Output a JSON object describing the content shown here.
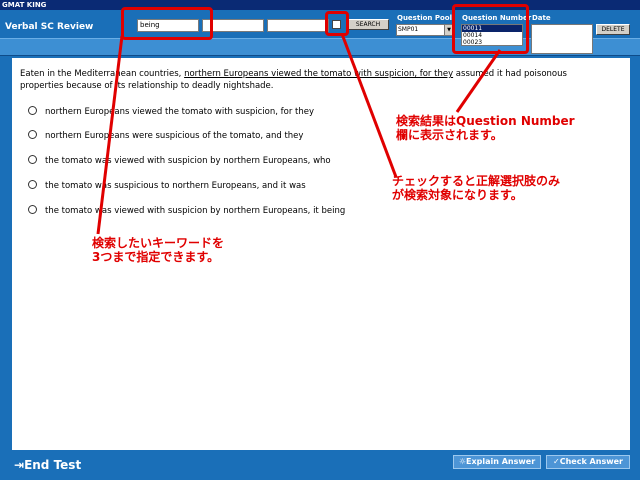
{
  "window": {
    "title": "GMAT KING"
  },
  "header": {
    "app_title": "Verbal SC Review",
    "keyword_inputs": [
      "being",
      "",
      ""
    ],
    "search_label": "SEARCH",
    "question_pool_label": "Question Pool",
    "question_pool_value": "SMP01",
    "question_number_label": "Question Number",
    "question_numbers": [
      "00011",
      "00014",
      "00023"
    ],
    "date_label": "Date",
    "delete_label": "DELETE"
  },
  "question": {
    "pre": "Eaten in the Mediterranean countries, ",
    "underlined": "northern Europeans viewed the tomato with suspicion, for they",
    "post": " assumed it had poisonous properties because of its relationship to deadly nightshade.",
    "options": [
      "northern Europeans viewed the tomato with suspicion, for they",
      "northern Europeans were suspicious of the tomato, and they",
      "the tomato was viewed with suspicion by northern Europeans, who",
      "the tomato was suspicious to northern Europeans, and it was",
      "the tomato was viewed with suspicion by northern Europeans, it being"
    ]
  },
  "footer": {
    "end_test": "End Test",
    "explain_answer": "Explain Answer",
    "check_answer": "Check Answer"
  },
  "annotations": {
    "note_keyword_1": "検索したいキーワードを",
    "note_keyword_2": "3つまで指定できます。",
    "note_check_1": "チェックすると正解選択肢のみ",
    "note_check_2": "が検索対象になります。",
    "note_result_1": "検索結果はQuestion Number",
    "note_result_2": "欄に表示されます。"
  },
  "colors": {
    "annotation": "#e00000",
    "background": "#1a6fb8",
    "titlebar": "#0a2a74"
  }
}
